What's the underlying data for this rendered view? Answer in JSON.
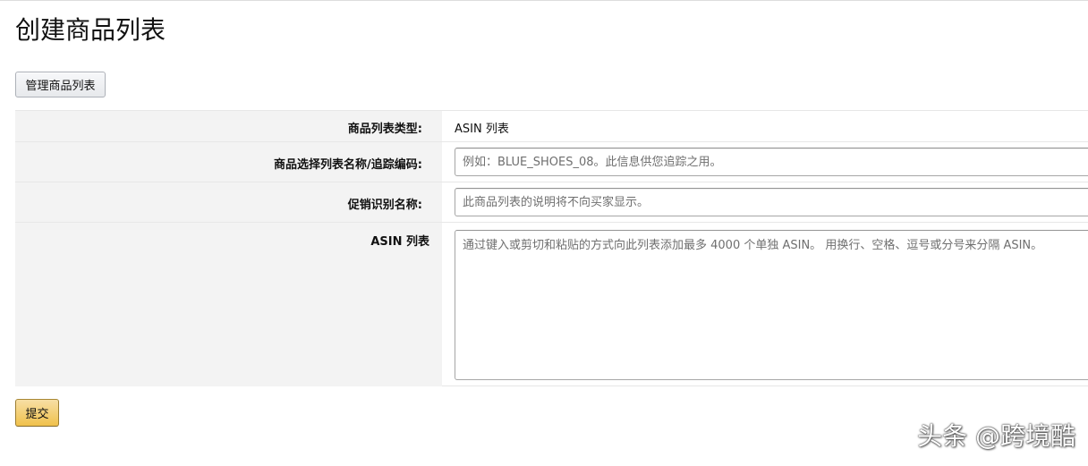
{
  "page": {
    "title": "创建商品列表"
  },
  "toolbar": {
    "manage_label": "管理商品列表"
  },
  "form": {
    "list_type": {
      "label": "商品列表类型:",
      "value": "ASIN 列表"
    },
    "list_name": {
      "label": "商品选择列表名称/追踪编码:",
      "placeholder": "例如：BLUE_SHOES_08。此信息供您追踪之用。"
    },
    "promo_name": {
      "label": "促销识别名称:",
      "placeholder": "此商品列表的说明将不向买家显示。"
    },
    "asin_list": {
      "label": "ASIN 列表",
      "placeholder": "通过键入或剪切和粘贴的方式向此列表添加最多 4000 个单独 ASIN。 用换行、空格、逗号或分号来分隔 ASIN。"
    }
  },
  "actions": {
    "submit_label": "提交"
  },
  "watermark": {
    "text": "头条 @跨境酷"
  }
}
